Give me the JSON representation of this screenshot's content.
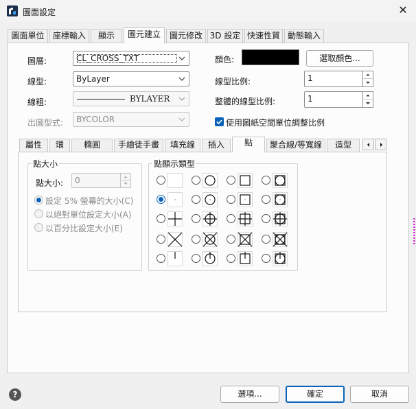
{
  "window": {
    "title": "圖面設定",
    "close_glyph": "✕"
  },
  "tabs": [
    "圖面單位",
    "座標輸入",
    "顯示",
    "圖元建立",
    "圖元修改",
    "3D 設定",
    "快速性質",
    "動態輸入"
  ],
  "form": {
    "layer_label": "圖層:",
    "layer_value": "CL_CROSS_TXT",
    "linetype_label": "線型:",
    "linetype_value": "ByLayer",
    "lineweight_label": "線粗:",
    "lineweight_value": "BYLAYER",
    "plotstyle_label": "出圖型式:",
    "plotstyle_value": "BYCOLOR",
    "color_label": "顏色:",
    "color_value": "#000000",
    "select_color_button": "選取顏色...",
    "ltscale_label": "線型比例:",
    "ltscale_value": "1",
    "global_ltscale_label": "整體的線型比例:",
    "global_ltscale_value": "1",
    "paperspace_check_label": "使用圖紙空間單位調整比例",
    "paperspace_checked": true
  },
  "subtabs": [
    "屬性",
    "環",
    "橢圓",
    "手繪徒手畫",
    "填充線",
    "插入",
    "點",
    "聚合線/等寬線",
    "造型"
  ],
  "point_size": {
    "group_label": "點大小",
    "size_label": "點大小:",
    "size_value": "0",
    "options": [
      "設定 5% 螢幕的大小(C)",
      "以絕對單位設定大小(A)",
      "以百分比設定大小(E)"
    ],
    "selected": 0
  },
  "point_display": {
    "group_label": "點顯示類型",
    "selected_row": 1,
    "selected_col": 0
  },
  "footer": {
    "help_glyph": "?",
    "options_button": "選項...",
    "ok_button": "確定",
    "cancel_button": "取消"
  }
}
